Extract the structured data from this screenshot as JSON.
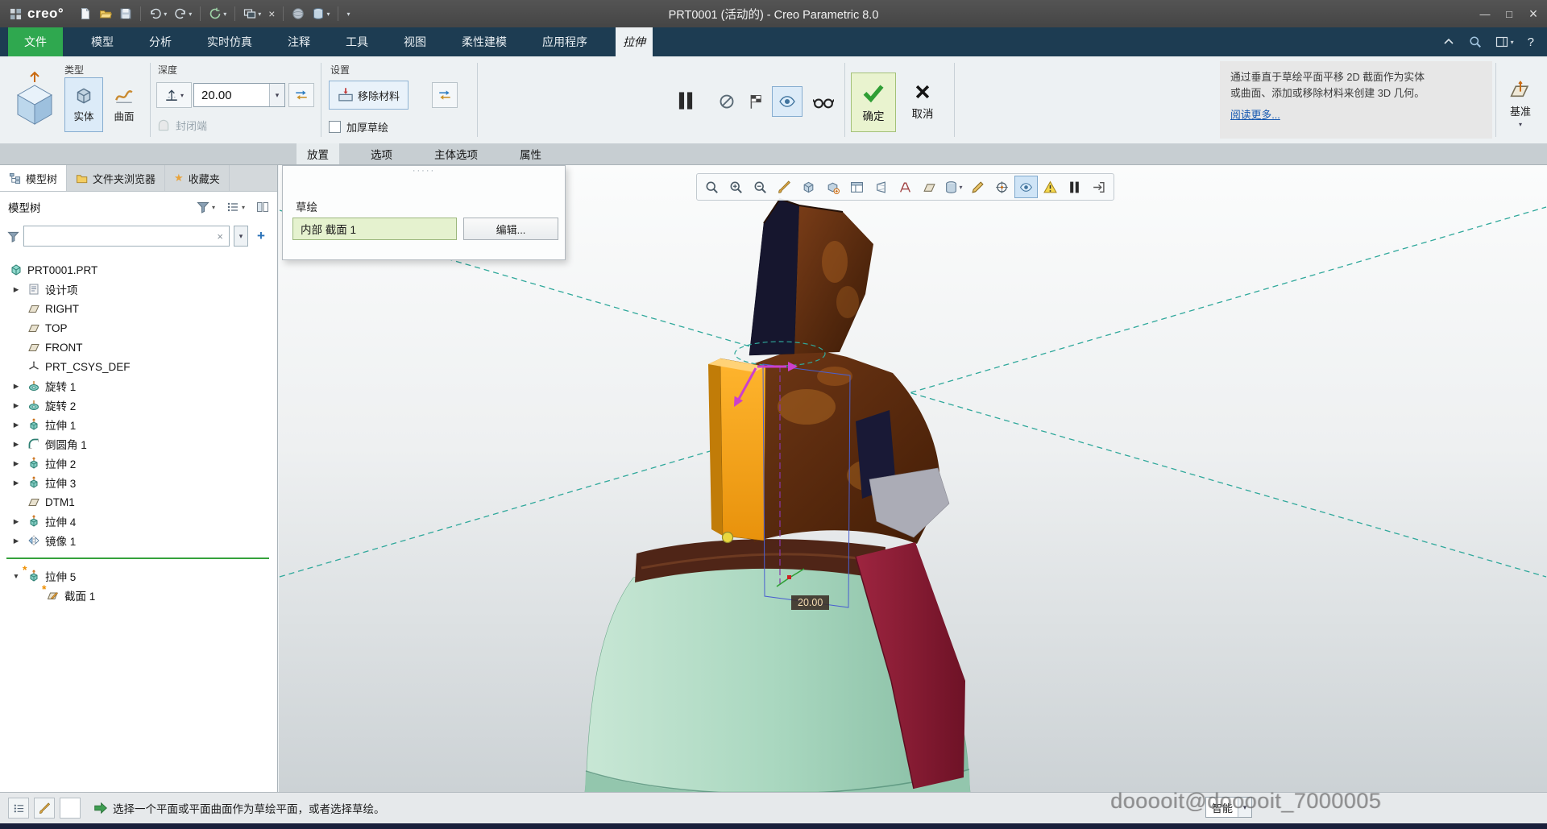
{
  "window": {
    "logo": "creo°",
    "title": "PRT0001 (活动的) - Creo Parametric 8.0",
    "minimize": "—",
    "maximize": "□",
    "close": "×"
  },
  "glyphs": {
    "dropdown": "▾",
    "collapsed": "▶",
    "expanded": "▼",
    "clear": "×",
    "star": "★",
    "plus": "+",
    "question": "?",
    "dots": "·····",
    "new_mark": "*"
  },
  "ribbon_tabs": [
    "文件",
    "模型",
    "分析",
    "实时仿真",
    "注释",
    "工具",
    "视图",
    "柔性建模",
    "应用程序",
    "拉伸"
  ],
  "ribbon": {
    "type_group": {
      "label": "类型",
      "solid": "实体",
      "surface": "曲面"
    },
    "depth_group": {
      "label": "深度",
      "value": "20.00",
      "capped": "封闭端"
    },
    "settings_group": {
      "label": "设置",
      "remove_material": "移除材料",
      "thicken": "加厚草绘"
    },
    "ok": "确定",
    "cancel": "取消",
    "datum_label": "基准",
    "help": {
      "line1": "通过垂直于草绘平面平移 2D 截面作为实体",
      "line2": "或曲面、添加或移除材料来创建 3D 几何。",
      "link": "阅读更多..."
    }
  },
  "dashboard_tabs": [
    "放置",
    "选项",
    "主体选项",
    "属性"
  ],
  "placement_panel": {
    "sketch_label": "草绘",
    "sketch_value": "内部 截面 1",
    "edit_button": "编辑..."
  },
  "model_tree": {
    "tabs": [
      "模型树",
      "文件夹浏览器",
      "收藏夹"
    ],
    "header": "模型树",
    "items": [
      {
        "label": "PRT0001.PRT",
        "icon": "part"
      },
      {
        "label": "设计项",
        "icon": "design-items"
      },
      {
        "label": "RIGHT",
        "icon": "datum-plane"
      },
      {
        "label": "TOP",
        "icon": "datum-plane"
      },
      {
        "label": "FRONT",
        "icon": "datum-plane"
      },
      {
        "label": "PRT_CSYS_DEF",
        "icon": "coordinate-system"
      },
      {
        "label": "旋转 1",
        "icon": "revolve"
      },
      {
        "label": "旋转 2",
        "icon": "revolve"
      },
      {
        "label": "拉伸 1",
        "icon": "extrude"
      },
      {
        "label": "倒圆角 1",
        "icon": "round"
      },
      {
        "label": "拉伸 2",
        "icon": "extrude"
      },
      {
        "label": "拉伸 3",
        "icon": "extrude"
      },
      {
        "label": "DTM1",
        "icon": "datum-plane"
      },
      {
        "label": "拉伸 4",
        "icon": "extrude"
      },
      {
        "label": "镜像 1",
        "icon": "mirror"
      },
      {
        "label": "拉伸 5",
        "icon": "extrude"
      },
      {
        "label": "截面 1",
        "icon": "sketch"
      }
    ]
  },
  "graphics": {
    "dimension_label": "20.00"
  },
  "status_bar": {
    "message": "选择一个平面或平面曲面作为草绘平面，或者选择草绘。",
    "filter_value": "智能"
  },
  "watermark": "dooooit@dooooit_7000005"
}
